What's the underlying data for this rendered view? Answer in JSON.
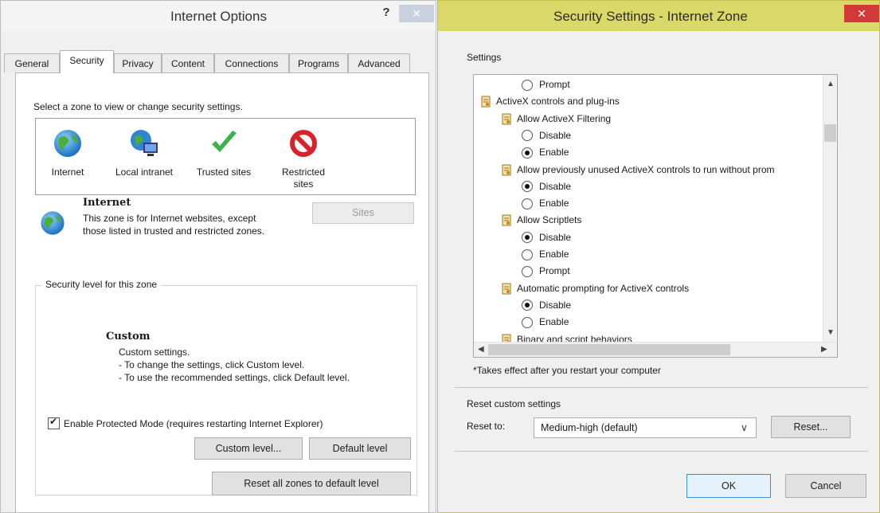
{
  "left_window": {
    "title": "Internet Options",
    "help": "?",
    "close": "✕",
    "tabs": [
      "General",
      "Security",
      "Privacy",
      "Content",
      "Connections",
      "Programs",
      "Advanced"
    ],
    "active_tab": "Security",
    "zone_prompt": "Select a zone to view or change security settings.",
    "zones": [
      {
        "label": "Internet",
        "icon": "globe-icon"
      },
      {
        "label": "Local intranet",
        "icon": "intranet-icon"
      },
      {
        "label": "Trusted sites",
        "icon": "checkmark-icon"
      },
      {
        "label": "Restricted\nsites",
        "icon": "no-entry-icon"
      }
    ],
    "zone_title": "Internet",
    "zone_description": "This zone is for Internet websites, except those listed in trusted and restricted zones.",
    "sites_button": "Sites",
    "security_level_group": "Security level for this zone",
    "level_title": "Custom",
    "level_lines": [
      "Custom settings.",
      "- To change the settings, click Custom level.",
      "- To use the recommended settings, click Default level."
    ],
    "protected_mode_label": "Enable Protected Mode (requires restarting Internet Explorer)",
    "protected_mode_checked": true,
    "custom_level_button": "Custom level...",
    "default_level_button": "Default level",
    "reset_all_button": "Reset all zones to default level"
  },
  "right_window": {
    "title": "Security Settings - Internet Zone",
    "close": "✕",
    "settings_label": "Settings",
    "tree": [
      {
        "kind": "radio",
        "label": "Prompt",
        "checked": false,
        "indent": 2
      },
      {
        "kind": "category",
        "label": "ActiveX controls and plug-ins",
        "indent": 0
      },
      {
        "kind": "setting",
        "label": "Allow ActiveX Filtering",
        "indent": 1
      },
      {
        "kind": "radio",
        "label": "Disable",
        "checked": false,
        "indent": 2
      },
      {
        "kind": "radio",
        "label": "Enable",
        "checked": true,
        "indent": 2
      },
      {
        "kind": "setting",
        "label": "Allow previously unused ActiveX controls to run without prom",
        "indent": 1
      },
      {
        "kind": "radio",
        "label": "Disable",
        "checked": true,
        "indent": 2
      },
      {
        "kind": "radio",
        "label": "Enable",
        "checked": false,
        "indent": 2
      },
      {
        "kind": "setting",
        "label": "Allow Scriptlets",
        "indent": 1
      },
      {
        "kind": "radio",
        "label": "Disable",
        "checked": true,
        "indent": 2
      },
      {
        "kind": "radio",
        "label": "Enable",
        "checked": false,
        "indent": 2
      },
      {
        "kind": "radio",
        "label": "Prompt",
        "checked": false,
        "indent": 2
      },
      {
        "kind": "setting",
        "label": "Automatic prompting for ActiveX controls",
        "indent": 1
      },
      {
        "kind": "radio",
        "label": "Disable",
        "checked": true,
        "indent": 2
      },
      {
        "kind": "radio",
        "label": "Enable",
        "checked": false,
        "indent": 2
      },
      {
        "kind": "setting",
        "label": "Binary and script behaviors",
        "indent": 1
      }
    ],
    "restart_note": "*Takes effect after you restart your computer",
    "reset_group_label": "Reset custom settings",
    "reset_to_label": "Reset to:",
    "reset_to_value": "Medium-high (default)",
    "reset_button": "Reset...",
    "ok_button": "OK",
    "cancel_button": "Cancel"
  },
  "colors": {
    "right_titlebar": "#dbd86a",
    "close_red": "#d23a3a"
  }
}
